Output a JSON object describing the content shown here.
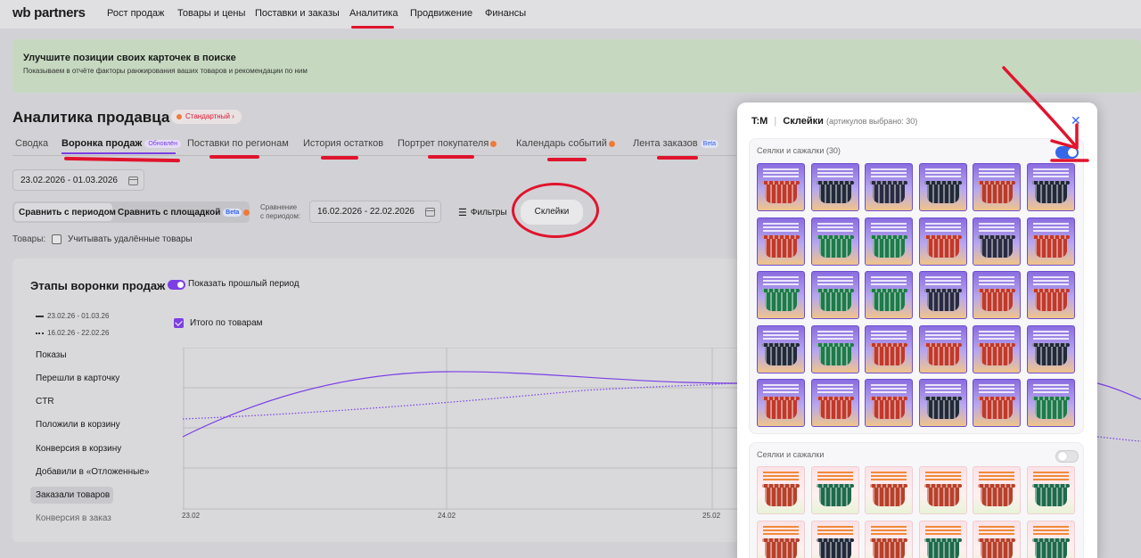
{
  "nav": {
    "logo": "wb partners",
    "items": [
      "Рост продаж",
      "Товары и цены",
      "Поставки и заказы",
      "Аналитика",
      "Продвижение",
      "Финансы"
    ],
    "active": "Аналитика"
  },
  "banner": {
    "title": "Улучшите позиции своих карточек в поиске",
    "subtitle": "Показываем в отчёте факторы ранжирования ваших товаров и рекомендации по ним"
  },
  "page": {
    "title": "Аналитика продавца",
    "plan_badge": "Стандартный"
  },
  "tabs": [
    {
      "label": "Сводка"
    },
    {
      "label": "Воронка продаж",
      "tag": "Обновлён"
    },
    {
      "label": "Поставки по регионам"
    },
    {
      "label": "История остатков"
    },
    {
      "label": "Портрет покупателя"
    },
    {
      "label": "Календарь событий"
    },
    {
      "label": "Лента заказов",
      "tag": "Beta"
    }
  ],
  "filters": {
    "date_range": "23.02.2026 - 01.03.2026",
    "compare_period_btn": "Сравнить с периодом",
    "compare_platform_btn": "Сравнить с площадкой",
    "compare_platform_tag": "Beta",
    "compare_label": "Сравнение с периодом:",
    "compare_label_1": "Сравнение",
    "compare_label_2": "с периодом:",
    "compare_range": "16.02.2026 - 22.02.2026",
    "filters_btn": "Фильтры",
    "skleiki_btn": "Склейки",
    "goods_label": "Товары:",
    "deleted_goods": "Учитывать удалённые товары"
  },
  "funnel": {
    "title": "Этапы воронки продаж",
    "show_prev": "Показать прошлый период",
    "legend_current": "23.02.26 - 01.03.26",
    "legend_prev": "16.02.26 - 22.02.26",
    "total_by_goods": "Итого по товарам",
    "metrics": [
      "Показы",
      "Перешли в карточку",
      "CTR",
      "Положили в корзину",
      "Конверсия в корзину",
      "Добавили в «Отложенные»",
      "Заказали товаров",
      "Конверсия в заказ"
    ],
    "active_metric": "Заказали товаров"
  },
  "chart_data": {
    "type": "line",
    "x": [
      "23.02",
      "24.02",
      "25.02"
    ],
    "series": [
      {
        "style": "solid",
        "color": "#7b3fe4"
      },
      {
        "style": "dotted",
        "color": "#7b3fe4"
      }
    ],
    "grid": true
  },
  "panel": {
    "brand": "T:M",
    "title": "Склейки",
    "count_text": "(артикулов выбрано: 30)",
    "section1_label": "Сеялки и сажалки",
    "section1_count": "(30)",
    "section1_enabled": true,
    "section2_label": "Сеялки и сажалки",
    "section2_enabled": false,
    "grid1_colors": [
      "#c0392b",
      "#222a3a",
      "#2a2a44",
      "#222a3a",
      "#b83a2a",
      "#222a3a",
      "#c0392b",
      "#1e7a4a",
      "#1e7a4a",
      "#c0392b",
      "#2a2a44",
      "#c0392b",
      "#1e7a4a",
      "#1e7a4a",
      "#1e7a4a",
      "#2a2a44",
      "#c0392b",
      "#c0392b",
      "#222a3a",
      "#1e7a4a",
      "#c0392b",
      "#c0392b",
      "#c0392b",
      "#222a3a",
      "#c0392b",
      "#c0392b",
      "#c0392b",
      "#222a3a",
      "#c0392b",
      "#1e7a4a"
    ],
    "grid2_colors": [
      "#b8402a",
      "#1e6a4a",
      "#b8402a",
      "#b8402a",
      "#b8402a",
      "#1e6a4a",
      "#b8402a",
      "#222a3a",
      "#b8402a",
      "#1e6a4a",
      "#b8402a",
      "#1e6a4a"
    ]
  }
}
